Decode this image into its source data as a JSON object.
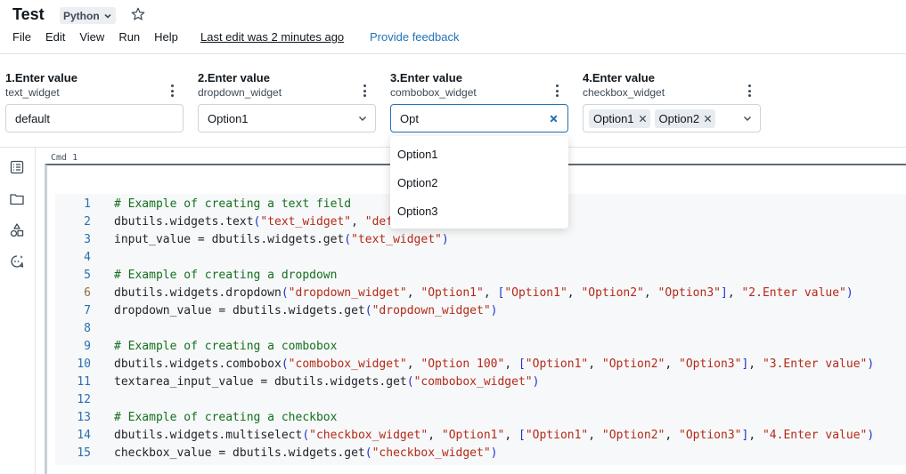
{
  "header": {
    "title": "Test",
    "language": "Python",
    "menu": [
      "File",
      "Edit",
      "View",
      "Run",
      "Help"
    ],
    "last_edit": "Last edit was 2 minutes ago",
    "feedback": "Provide feedback"
  },
  "widgets": [
    {
      "label": "1.Enter value",
      "name": "text_widget",
      "value": "default"
    },
    {
      "label": "2.Enter value",
      "name": "dropdown_widget",
      "value": "Option1"
    },
    {
      "label": "3.Enter value",
      "name": "combobox_widget",
      "value": "Opt"
    },
    {
      "label": "4.Enter value",
      "name": "checkbox_widget",
      "chips": [
        "Option1",
        "Option2"
      ]
    }
  ],
  "combobox_options": [
    "Option1",
    "Option2",
    "Option3"
  ],
  "rail_icons": [
    "table-of-contents-icon",
    "folder-icon",
    "shapes-icon",
    "assistant-icon"
  ],
  "cell": {
    "label": "Cmd 1",
    "active_line": 6,
    "lines": [
      {
        "n": "1",
        "segs": [
          [
            "cm",
            "# Example of creating a text field"
          ]
        ]
      },
      {
        "n": "2",
        "segs": [
          [
            "pl",
            "dbutils.widgets.text"
          ],
          [
            "br",
            "("
          ],
          [
            "st",
            "\"text_widget\""
          ],
          [
            "pl",
            ", "
          ],
          [
            "st",
            "\"def"
          ]
        ]
      },
      {
        "n": "3",
        "segs": [
          [
            "pl",
            "input_value = dbutils.widgets.get"
          ],
          [
            "br",
            "("
          ],
          [
            "st",
            "\"text_widget\""
          ],
          [
            "br",
            ")"
          ]
        ]
      },
      {
        "n": "4",
        "segs": []
      },
      {
        "n": "5",
        "segs": [
          [
            "cm",
            "# Example of creating a dropdown"
          ]
        ]
      },
      {
        "n": "6",
        "segs": [
          [
            "pl",
            "dbutils.widgets.dropdown"
          ],
          [
            "br",
            "("
          ],
          [
            "st",
            "\"dropdown_widget\""
          ],
          [
            "pl",
            ", "
          ],
          [
            "st",
            "\"Option1\""
          ],
          [
            "pl",
            ", "
          ],
          [
            "br",
            "["
          ],
          [
            "st",
            "\"Option1\""
          ],
          [
            "pl",
            ", "
          ],
          [
            "st",
            "\"Option2\""
          ],
          [
            "pl",
            ", "
          ],
          [
            "st",
            "\"Option3\""
          ],
          [
            "br",
            "]"
          ],
          [
            "pl",
            ", "
          ],
          [
            "st",
            "\"2.Enter value\""
          ],
          [
            "br",
            ")"
          ]
        ]
      },
      {
        "n": "7",
        "segs": [
          [
            "pl",
            "dropdown_value = dbutils.widgets.get"
          ],
          [
            "br",
            "("
          ],
          [
            "st",
            "\"dropdown_widget\""
          ],
          [
            "br",
            ")"
          ]
        ]
      },
      {
        "n": "8",
        "segs": []
      },
      {
        "n": "9",
        "segs": [
          [
            "cm",
            "# Example of creating a combobox"
          ]
        ]
      },
      {
        "n": "10",
        "segs": [
          [
            "pl",
            "dbutils.widgets.combobox"
          ],
          [
            "br",
            "("
          ],
          [
            "st",
            "\"combobox_widget\""
          ],
          [
            "pl",
            ", "
          ],
          [
            "st",
            "\"Option 100\""
          ],
          [
            "pl",
            ", "
          ],
          [
            "br",
            "["
          ],
          [
            "st",
            "\"Option1\""
          ],
          [
            "pl",
            ", "
          ],
          [
            "st",
            "\"Option2\""
          ],
          [
            "pl",
            ", "
          ],
          [
            "st",
            "\"Option3\""
          ],
          [
            "br",
            "]"
          ],
          [
            "pl",
            ", "
          ],
          [
            "st",
            "\"3.Enter value\""
          ],
          [
            "br",
            ")"
          ]
        ]
      },
      {
        "n": "11",
        "segs": [
          [
            "pl",
            "textarea_input_value = dbutils.widgets.get"
          ],
          [
            "br",
            "("
          ],
          [
            "st",
            "\"combobox_widget\""
          ],
          [
            "br",
            ")"
          ]
        ]
      },
      {
        "n": "12",
        "segs": []
      },
      {
        "n": "13",
        "segs": [
          [
            "cm",
            "# Example of creating a checkbox"
          ]
        ]
      },
      {
        "n": "14",
        "segs": [
          [
            "pl",
            "dbutils.widgets.multiselect"
          ],
          [
            "br",
            "("
          ],
          [
            "st",
            "\"checkbox_widget\""
          ],
          [
            "pl",
            ", "
          ],
          [
            "st",
            "\"Option1\""
          ],
          [
            "pl",
            ", "
          ],
          [
            "br",
            "["
          ],
          [
            "st",
            "\"Option1\""
          ],
          [
            "pl",
            ", "
          ],
          [
            "st",
            "\"Option2\""
          ],
          [
            "pl",
            ", "
          ],
          [
            "st",
            "\"Option3\""
          ],
          [
            "br",
            "]"
          ],
          [
            "pl",
            ", "
          ],
          [
            "st",
            "\"4.Enter value\""
          ],
          [
            "br",
            ")"
          ]
        ]
      },
      {
        "n": "15",
        "segs": [
          [
            "pl",
            "checkbox_value = dbutils.widgets.get"
          ],
          [
            "br",
            "("
          ],
          [
            "st",
            "\"checkbox_widget\""
          ],
          [
            "br",
            ")"
          ]
        ]
      }
    ]
  }
}
